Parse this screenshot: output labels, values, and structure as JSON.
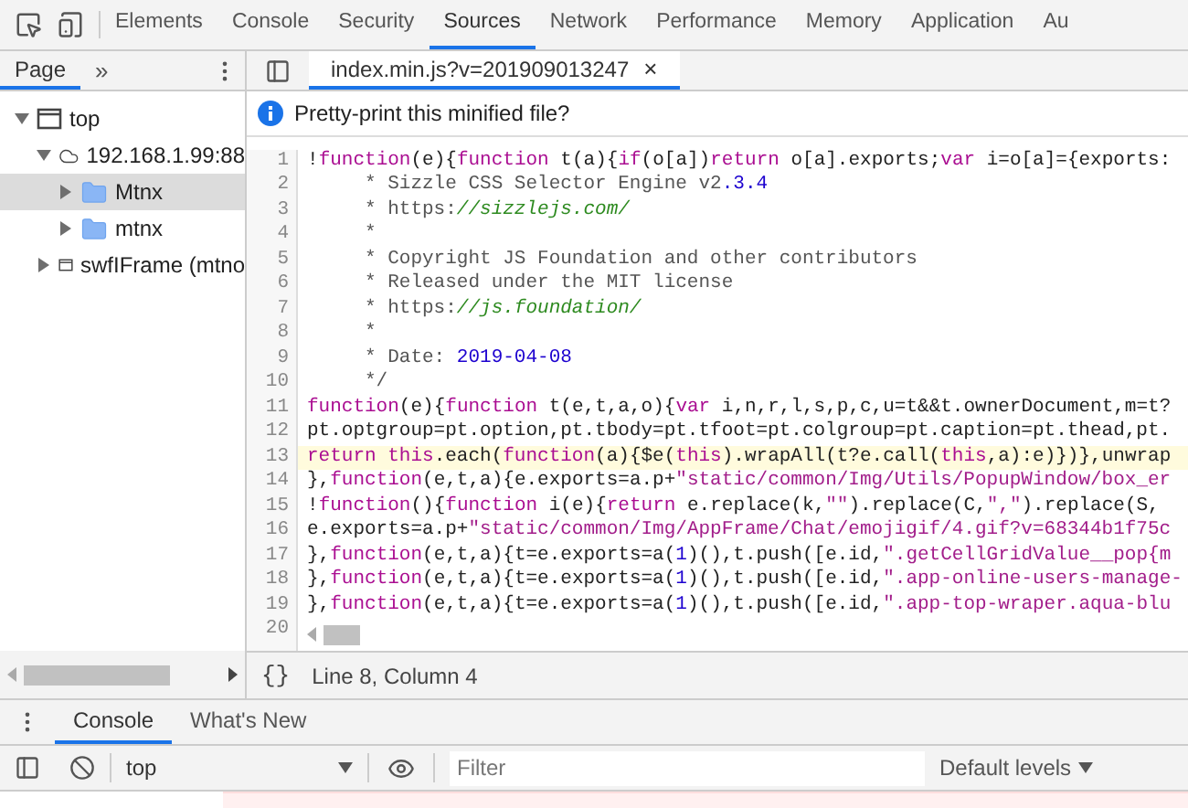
{
  "main_tabs": [
    {
      "label": "Elements",
      "selected": false
    },
    {
      "label": "Console",
      "selected": false
    },
    {
      "label": "Security",
      "selected": false
    },
    {
      "label": "Sources",
      "selected": true
    },
    {
      "label": "Network",
      "selected": false
    },
    {
      "label": "Performance",
      "selected": false
    },
    {
      "label": "Memory",
      "selected": false
    },
    {
      "label": "Application",
      "selected": false
    },
    {
      "label": "Au",
      "selected": false
    }
  ],
  "navigator": {
    "tabs": [
      {
        "label": "Page",
        "selected": true
      }
    ],
    "more": "»",
    "tree": [
      {
        "label": "top",
        "kind": "frame",
        "expanded": true,
        "selected": false,
        "children": [
          {
            "label": "192.168.1.99:88",
            "kind": "domain",
            "expanded": true,
            "selected": false,
            "children": [
              {
                "label": "Mtnx",
                "kind": "folder",
                "expanded": false,
                "selected": true
              },
              {
                "label": "mtnx",
                "kind": "folder",
                "expanded": false,
                "selected": false
              }
            ]
          },
          {
            "label": "swfIFrame (mtno",
            "kind": "frame",
            "expanded": false,
            "selected": false
          }
        ]
      }
    ]
  },
  "editor": {
    "tabs": [
      {
        "label": "index.min.js?v=201909013247",
        "selected": true,
        "close": "×"
      }
    ],
    "infobar": "Pretty-print this minified file?",
    "lines": [
      {
        "number": "1",
        "highlighted": false,
        "segs": [
          {
            "kind": "p",
            "t": "!"
          },
          {
            "kind": "kw",
            "t": "function"
          },
          {
            "kind": "p",
            "t": "(e){"
          },
          {
            "kind": "kw",
            "t": "function"
          },
          {
            "kind": "p",
            "t": " t(a){"
          },
          {
            "kind": "kw",
            "t": "if"
          },
          {
            "kind": "p",
            "t": "(o[a])"
          },
          {
            "kind": "kw",
            "t": "return"
          },
          {
            "kind": "p",
            "t": " o[a].exports;"
          },
          {
            "kind": "kw",
            "t": "var"
          },
          {
            "kind": "p",
            "t": " i=o[a]={exports:"
          }
        ]
      },
      {
        "number": "2",
        "highlighted": false,
        "segs": [
          {
            "kind": "c",
            "t": "     * Sizzle CSS Selector Engine v2"
          },
          {
            "kind": "n",
            "t": ".3.4"
          }
        ]
      },
      {
        "number": "3",
        "highlighted": false,
        "segs": [
          {
            "kind": "c",
            "t": "     * https:"
          },
          {
            "kind": "u",
            "t": "//sizzlejs.com/"
          }
        ]
      },
      {
        "number": "4",
        "highlighted": false,
        "segs": [
          {
            "kind": "c",
            "t": "     *"
          }
        ]
      },
      {
        "number": "5",
        "highlighted": false,
        "segs": [
          {
            "kind": "c",
            "t": "     * Copyright JS Foundation and other contributors"
          }
        ]
      },
      {
        "number": "6",
        "highlighted": false,
        "segs": [
          {
            "kind": "c",
            "t": "     * Released under the MIT license"
          }
        ]
      },
      {
        "number": "7",
        "highlighted": false,
        "segs": [
          {
            "kind": "c",
            "t": "     * https:"
          },
          {
            "kind": "u",
            "t": "//js.foundation/"
          }
        ]
      },
      {
        "number": "8",
        "highlighted": false,
        "segs": [
          {
            "kind": "c",
            "t": "     *"
          }
        ]
      },
      {
        "number": "9",
        "highlighted": false,
        "segs": [
          {
            "kind": "c",
            "t": "     * Date: "
          },
          {
            "kind": "n",
            "t": "2019-04-08"
          }
        ]
      },
      {
        "number": "10",
        "highlighted": false,
        "segs": [
          {
            "kind": "c",
            "t": "     */"
          }
        ]
      },
      {
        "number": "11",
        "highlighted": false,
        "segs": [
          {
            "kind": "kw",
            "t": "function"
          },
          {
            "kind": "p",
            "t": "(e){"
          },
          {
            "kind": "kw",
            "t": "function"
          },
          {
            "kind": "p",
            "t": " t(e,t,a,o){"
          },
          {
            "kind": "kw",
            "t": "var"
          },
          {
            "kind": "p",
            "t": " i,n,r,l,s,p,c,u=t&&t.ownerDocument,m=t?"
          }
        ]
      },
      {
        "number": "12",
        "highlighted": false,
        "segs": [
          {
            "kind": "p",
            "t": "pt.optgroup=pt.option,pt.tbody=pt.tfoot=pt.colgroup=pt.caption=pt.thead,pt."
          }
        ]
      },
      {
        "number": "13",
        "highlighted": true,
        "segs": [
          {
            "kind": "kw",
            "t": "return this"
          },
          {
            "kind": "p",
            "t": ".each("
          },
          {
            "kind": "kw",
            "t": "function"
          },
          {
            "kind": "p",
            "t": "(a){$e("
          },
          {
            "kind": "kw",
            "t": "this"
          },
          {
            "kind": "p",
            "t": ").wrapAll(t?e.call("
          },
          {
            "kind": "kw",
            "t": "this"
          },
          {
            "kind": "p",
            "t": ",a):e)})},unwrap"
          }
        ]
      },
      {
        "number": "14",
        "highlighted": false,
        "segs": [
          {
            "kind": "p",
            "t": "},"
          },
          {
            "kind": "kw",
            "t": "function"
          },
          {
            "kind": "p",
            "t": "(e,t,a){e.exports=a.p+"
          },
          {
            "kind": "s",
            "t": "\"static/common/Img/Utils/PopupWindow/box_er"
          }
        ]
      },
      {
        "number": "15",
        "highlighted": false,
        "segs": [
          {
            "kind": "p",
            "t": "!"
          },
          {
            "kind": "kw",
            "t": "function"
          },
          {
            "kind": "p",
            "t": "(){"
          },
          {
            "kind": "kw",
            "t": "function"
          },
          {
            "kind": "p",
            "t": " i(e){"
          },
          {
            "kind": "kw",
            "t": "return"
          },
          {
            "kind": "p",
            "t": " e.replace(k,"
          },
          {
            "kind": "s",
            "t": "\"\""
          },
          {
            "kind": "p",
            "t": ").replace(C,"
          },
          {
            "kind": "s",
            "t": "\",\""
          },
          {
            "kind": "p",
            "t": ").replace(S,"
          }
        ]
      },
      {
        "number": "16",
        "highlighted": false,
        "segs": [
          {
            "kind": "p",
            "t": "e.exports=a.p+"
          },
          {
            "kind": "s",
            "t": "\"static/common/Img/AppFrame/Chat/emojigif/4.gif?v=68344b1f75c"
          }
        ]
      },
      {
        "number": "17",
        "highlighted": false,
        "segs": [
          {
            "kind": "p",
            "t": "},"
          },
          {
            "kind": "kw",
            "t": "function"
          },
          {
            "kind": "p",
            "t": "(e,t,a){t=e.exports=a("
          },
          {
            "kind": "n",
            "t": "1"
          },
          {
            "kind": "p",
            "t": ")(),t.push([e.id,"
          },
          {
            "kind": "s",
            "t": "\".getCellGridValue__pop{m"
          }
        ]
      },
      {
        "number": "18",
        "highlighted": false,
        "segs": [
          {
            "kind": "p",
            "t": "},"
          },
          {
            "kind": "kw",
            "t": "function"
          },
          {
            "kind": "p",
            "t": "(e,t,a){t=e.exports=a("
          },
          {
            "kind": "n",
            "t": "1"
          },
          {
            "kind": "p",
            "t": ")(),t.push([e.id,"
          },
          {
            "kind": "s",
            "t": "\".app-online-users-manage-"
          }
        ]
      },
      {
        "number": "19",
        "highlighted": false,
        "segs": [
          {
            "kind": "p",
            "t": "},"
          },
          {
            "kind": "kw",
            "t": "function"
          },
          {
            "kind": "p",
            "t": "(e,t,a){t=e.exports=a("
          },
          {
            "kind": "n",
            "t": "1"
          },
          {
            "kind": "p",
            "t": ")(),t.push([e.id,"
          },
          {
            "kind": "s",
            "t": "\".app-top-wraper.aqua-blu"
          }
        ]
      }
    ],
    "last_line_number": "20",
    "format_button": "{}",
    "status": "Line 8, Column 4"
  },
  "drawer": {
    "tabs": [
      {
        "label": "Console",
        "selected": true
      },
      {
        "label": "What's New",
        "selected": false
      }
    ],
    "context": "top",
    "filter_placeholder": "Filter",
    "levels": "Default levels"
  }
}
